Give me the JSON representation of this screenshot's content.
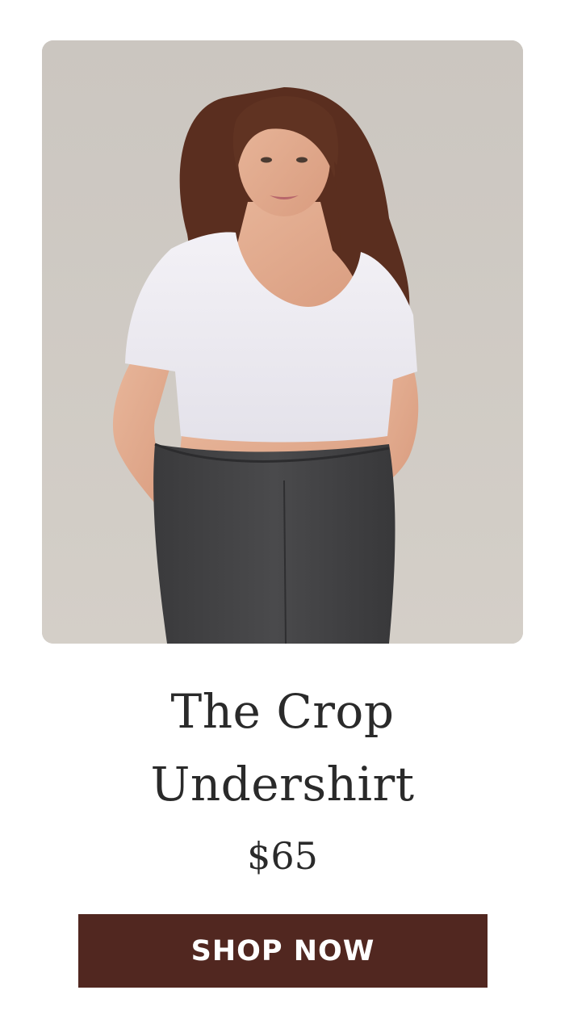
{
  "product": {
    "image_alt": "Woman wearing white crop undershirt and charcoal leggings",
    "title_line1": "The Crop",
    "title_line2": "Undershirt",
    "price": "$65",
    "cta_label": "SHOP NOW"
  },
  "colors": {
    "button_bg": "#512720",
    "button_text": "#ffffff",
    "text": "#2a2a2a",
    "image_bg": "#d3cec8"
  }
}
